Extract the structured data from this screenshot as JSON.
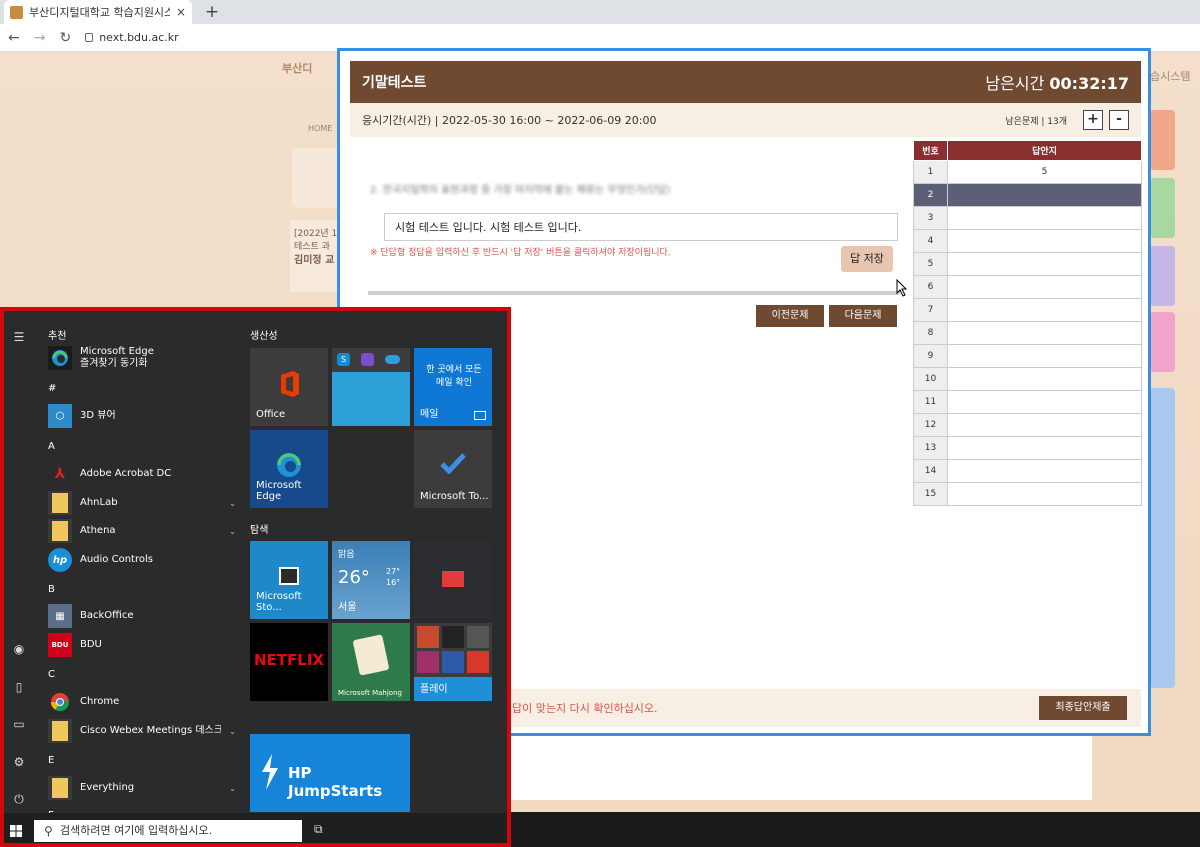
{
  "browser": {
    "tab_title": "부산디지털대학교 학습지원시스",
    "tab_close": "×",
    "new_tab": "+",
    "url": "next.bdu.ac.kr",
    "nav_back": "←",
    "nav_forward": "→",
    "nav_reload": "↻"
  },
  "background": {
    "logo_text": "부산디",
    "home_label": "HOME",
    "notice_lines": [
      "[2022년 1",
      "테스트 과",
      "김미정 교"
    ],
    "system_name": "습시스템"
  },
  "exam": {
    "title": "기말테스트",
    "time_label": "남은시간",
    "time_value": "00:32:17",
    "period_label": "응시기간(시간) | 2022-05-30 16:00 ~ 2022-06-09 20:00",
    "remaining_label": "남은문제 | 13개",
    "zoom_in": "+",
    "zoom_out": "-",
    "question_text": "2. 한국지털학의 표현과정 중 가장 마지막에 붙는 체류는 무엇인가(단답)",
    "answer_value": "시험 테스트 입니다. 시험 테스트 입니다.",
    "notice": "※ 단답형 정답을 입력하신 후 반드시 '답 저장' 버튼을 클릭하셔야 저장이됩니다.",
    "save_button": "답 저장",
    "prev_button": "이전문제",
    "next_button": "다음문제",
    "table_headers": [
      "번호",
      "답안지"
    ],
    "table_rows": [
      {
        "num": "1",
        "ans": "5"
      },
      {
        "num": "2",
        "ans": ""
      },
      {
        "num": "3",
        "ans": ""
      },
      {
        "num": "4",
        "ans": ""
      },
      {
        "num": "5",
        "ans": ""
      },
      {
        "num": "6",
        "ans": ""
      },
      {
        "num": "7",
        "ans": ""
      },
      {
        "num": "8",
        "ans": ""
      },
      {
        "num": "9",
        "ans": ""
      },
      {
        "num": "10",
        "ans": ""
      },
      {
        "num": "11",
        "ans": ""
      },
      {
        "num": "12",
        "ans": ""
      },
      {
        "num": "13",
        "ans": ""
      },
      {
        "num": "14",
        "ans": ""
      },
      {
        "num": "15",
        "ans": ""
      }
    ],
    "footer_text": "답이 맞는지 다시 확인하십시오.",
    "final_submit": "최종답안제출"
  },
  "start_menu": {
    "sections": {
      "recommended": "추천",
      "hash": "#",
      "a": "A",
      "b": "B",
      "c": "C",
      "e": "E",
      "f": "F"
    },
    "apps": [
      {
        "name": "Microsoft Edge\n즐겨찾기 동기화",
        "icon": "edge-icon",
        "color": "#1b1b1b"
      },
      {
        "name": "3D 뷰어",
        "icon": "3d-viewer-icon",
        "color": "#2e8bc9"
      },
      {
        "name": "Adobe Acrobat DC",
        "icon": "acrobat-icon",
        "color": "#2b2b2b"
      },
      {
        "name": "AhnLab",
        "icon": "folder-icon",
        "color": "#f0c75e"
      },
      {
        "name": "Athena",
        "icon": "folder-icon",
        "color": "#f0c75e"
      },
      {
        "name": "Audio Controls",
        "icon": "hp-icon",
        "color": "#1a8fd8"
      },
      {
        "name": "BackOffice",
        "icon": "backoffice-icon",
        "color": "#3c7bd9"
      },
      {
        "name": "BDU",
        "icon": "bdu-icon",
        "color": "#d0021b"
      },
      {
        "name": "Chrome",
        "icon": "chrome-icon",
        "color": "#2b2b2b"
      },
      {
        "name": "Cisco Webex Meetings 데스크...",
        "icon": "folder-icon",
        "color": "#f0c75e"
      },
      {
        "name": "Everything",
        "icon": "folder-icon",
        "color": "#f0c75e"
      }
    ],
    "tile_groups": {
      "productivity": "생산성",
      "explore": "탐색"
    },
    "tiles": {
      "office": "Office",
      "mail_top": "한 곳에서 모든\n메일 확인",
      "mail": "메일",
      "edge": "Microsoft Edge",
      "todo": "Microsoft To...",
      "store": "Microsoft Sto...",
      "weather_cond": "맑음",
      "weather_temp": "26°",
      "weather_hi": "27°",
      "weather_lo": "16°",
      "weather_city": "서울",
      "netflix": "NETFLIX",
      "mahjong": "Microsoft Mahjong",
      "play": "플레이",
      "hp": "HP JumpStarts"
    },
    "search_placeholder": "검색하려면 여기에 입력하십시오."
  }
}
